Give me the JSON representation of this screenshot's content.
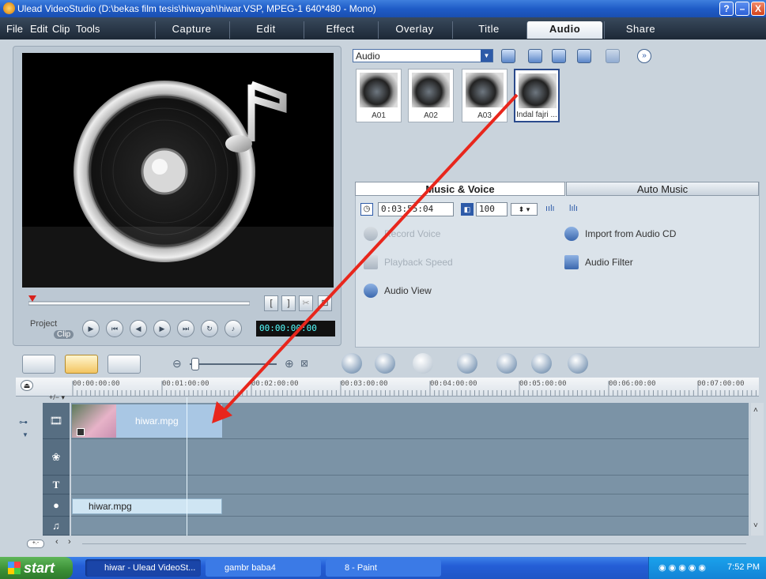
{
  "window": {
    "title": "Ulead VideoStudio (D:\\bekas film tesis\\hiwayah\\hiwar.VSP, MPEG-1 640*480 - Mono)",
    "buttons": [
      "?",
      "–",
      "X"
    ]
  },
  "menu": [
    "File",
    "Edit",
    "Clip",
    "Tools"
  ],
  "steps": [
    "Capture",
    "Edit",
    "Effect",
    "Overlay",
    "Title",
    "Audio",
    "Share"
  ],
  "active_step": "Audio",
  "preview": {
    "mode_project": "Project",
    "mode_clip": "Clip",
    "timecode": "00:00:00:00",
    "trim_in": "[",
    "trim_out": "]"
  },
  "library": {
    "category": "Audio",
    "items": [
      {
        "name": "A01"
      },
      {
        "name": "A02"
      },
      {
        "name": "A03"
      },
      {
        "name": "Indal fajri ..."
      }
    ],
    "selected_index": 3
  },
  "options": {
    "tabs": [
      "Music & Voice",
      "Auto Music"
    ],
    "duration": "0:03:55:04",
    "volume": "100",
    "record_voice": "Record Voice",
    "import_cd": "Import from Audio CD",
    "playback_speed": "Playback Speed",
    "audio_filter": "Audio Filter",
    "audio_view": "Audio View"
  },
  "timeline": {
    "ticks": [
      "00:00:00:00",
      "00:01:00:00",
      "00:02:00:00",
      "00:03:00:00",
      "00:04:00:00",
      "00:05:00:00",
      "00:06:00:00",
      "00:07:00:00"
    ],
    "video_clip": "hiwar.mpg",
    "voice_clip": "hiwar.mpg",
    "plus_minus": "+/− ▾"
  },
  "taskbar": {
    "start": "start",
    "tasks": [
      "hiwar - Ulead VideoSt...",
      "gambr baba4",
      "8 - Paint"
    ],
    "clock": "7:52 PM"
  },
  "colors": {
    "titlebar": "#1f5cc7",
    "menubar": "#1d2836",
    "arrow": "#e8261c",
    "taskbar": "#245ed6"
  }
}
